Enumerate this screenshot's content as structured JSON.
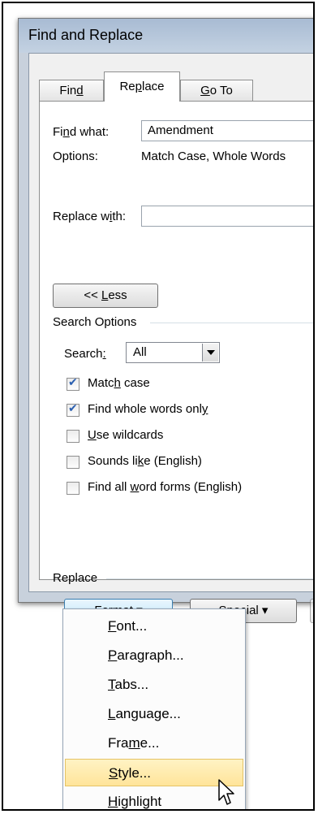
{
  "window": {
    "title": "Find and Replace"
  },
  "tabs": [
    {
      "pre": "Fin",
      "u": "d",
      "post": ""
    },
    {
      "pre": "Re",
      "u": "p",
      "post": "lace"
    },
    {
      "pre": "",
      "u": "G",
      "post": "o To"
    }
  ],
  "find_what": {
    "pre": "Fi",
    "u": "n",
    "post": "d what:",
    "value": "Amendment"
  },
  "options": {
    "label": "Options:",
    "value": "Match Case, Whole Words"
  },
  "replace_with": {
    "pre": "Replace w",
    "u": "i",
    "post": "th:",
    "value": ""
  },
  "less_button": {
    "pre": "<< ",
    "u": "L",
    "post": "ess"
  },
  "search_options": {
    "header": "Search Options",
    "search": {
      "pre": "Search",
      "u": ":",
      "post": "",
      "value": "All"
    },
    "checkboxes": [
      {
        "pre": "Matc",
        "u": "h",
        "post": " case",
        "checked": true
      },
      {
        "pre": "Find whole words onl",
        "u": "y",
        "post": "",
        "checked": true
      },
      {
        "pre": "",
        "u": "U",
        "post": "se wildcards",
        "checked": false
      },
      {
        "pre": "Sounds li",
        "u": "k",
        "post": "e (English)",
        "checked": false
      },
      {
        "pre": "Find all ",
        "u": "w",
        "post": "ord forms (English)",
        "checked": false
      }
    ]
  },
  "replace_group": {
    "header": "Replace",
    "format": {
      "pre": "F",
      "u": "o",
      "post": "rmat ▾"
    },
    "special": {
      "pre": "Sp",
      "u": "e",
      "post": "cial ▾"
    }
  },
  "format_menu": [
    {
      "pre": "",
      "u": "F",
      "post": "ont...",
      "highlighted": false
    },
    {
      "pre": "",
      "u": "P",
      "post": "aragraph...",
      "highlighted": false
    },
    {
      "pre": "",
      "u": "T",
      "post": "abs...",
      "highlighted": false
    },
    {
      "pre": "",
      "u": "L",
      "post": "anguage...",
      "highlighted": false
    },
    {
      "pre": "Fra",
      "u": "m",
      "post": "e...",
      "highlighted": false
    },
    {
      "pre": "",
      "u": "S",
      "post": "tyle...",
      "highlighted": true
    },
    {
      "pre": "",
      "u": "H",
      "post": "ighlight",
      "highlighted": false
    }
  ]
}
